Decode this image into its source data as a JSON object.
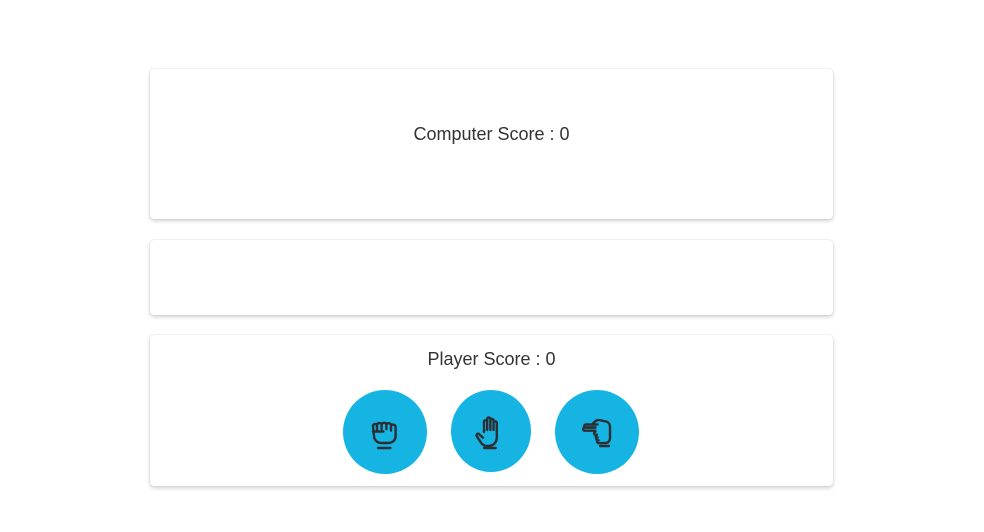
{
  "computer": {
    "score_label": "Computer Score : 0"
  },
  "result": {
    "message": ""
  },
  "player": {
    "score_label": "Player Score : 0",
    "choices": [
      {
        "name": "rock",
        "icon": "hand-rock-icon"
      },
      {
        "name": "paper",
        "icon": "hand-paper-icon"
      },
      {
        "name": "scissors",
        "icon": "hand-scissors-icon"
      }
    ]
  },
  "colors": {
    "button_bg": "#16b4e3",
    "icon_stroke": "#2b2f33",
    "text": "#333333"
  }
}
